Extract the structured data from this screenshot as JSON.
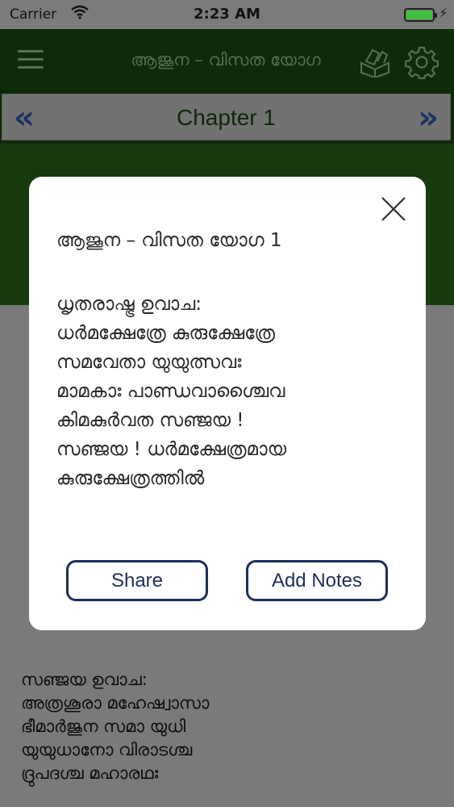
{
  "status_bar": {
    "carrier": "Carrier",
    "time": "2:23 AM"
  },
  "nav": {
    "title": "ആജൂന – വിസത യോഗ"
  },
  "chapter": {
    "title": "Chapter 1",
    "prev_icon": "double-chevron-left-icon",
    "next_icon": "double-chevron-right-icon"
  },
  "background_verse": {
    "lines": [
      "സഞ്ജയ ഉവാച:",
      "അത്രശൂരാ മഹേഷ്വാസാ",
      "ഭീമാർജുന സമാ യുധി",
      "യുയുധാനോ വിരാടശ്ച",
      "ദ്രുപദശ്ച മഹാരഥഃ"
    ]
  },
  "modal": {
    "title": "ആജൂന – വിസത യോഗ 1",
    "verse_lines": [
      "ധൃതരാഷ്ട്ര ഉവാച:",
      "ധർമക്ഷേത്രേ  കുരുക്ഷേത്രേ",
      "സമവേതാ യുയുത്സവഃ",
      "മാമകാഃ  പാണ്ഡവാശ്ചൈവ",
      "കിമകുർവത സഞ്ജയ !",
      "സഞ്ജയ ! ധർമക്ഷേത്രമായ",
      "കുരുക്ഷേത്രത്തിൽ"
    ],
    "share_label": "Share",
    "add_notes_label": "Add Notes"
  },
  "colors": {
    "nav_bg": "#0f2a09",
    "button_border": "#1d2f5a",
    "battery": "#3fbf3f"
  }
}
